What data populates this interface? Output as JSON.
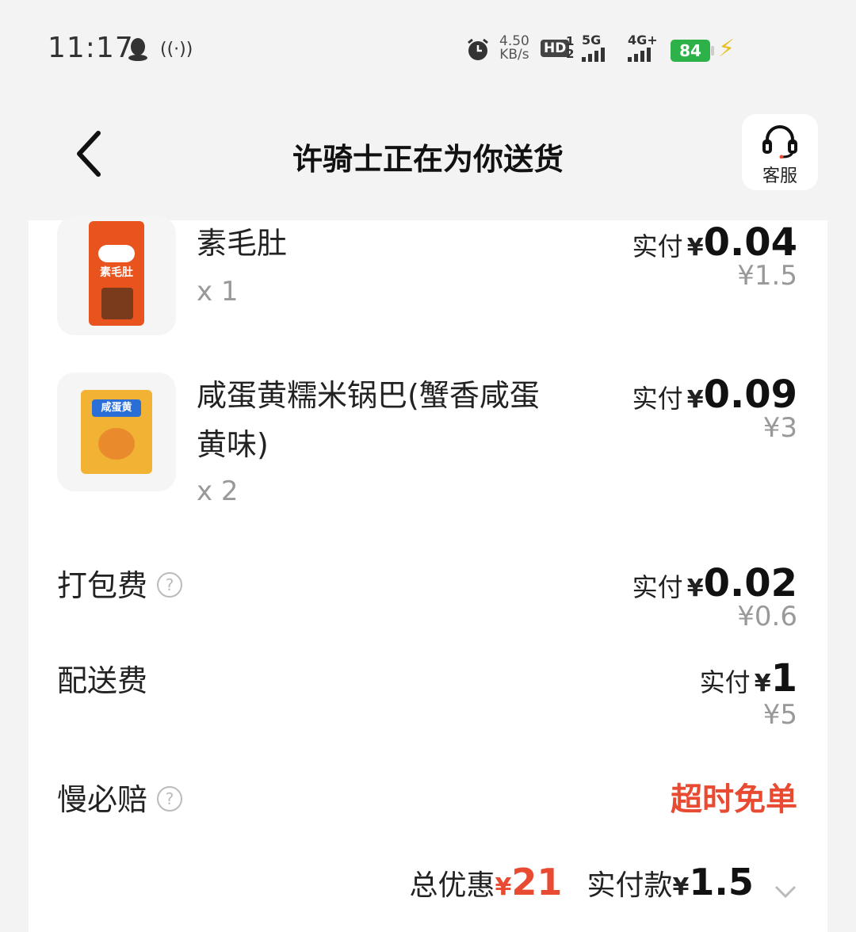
{
  "status_bar": {
    "time": "11:17",
    "speed_value": "4.50",
    "speed_unit": "KB/s",
    "hd": "HD",
    "hd_sub": "1\n2",
    "net1": "5G",
    "net2": "4G+",
    "battery": "84"
  },
  "header": {
    "title": "许骑士正在为你送货",
    "cs_label": "客服"
  },
  "items": [
    {
      "name": "素毛肚",
      "qty": "x 1",
      "paid_label": "实付",
      "currency": "¥",
      "paid": "0.04",
      "original": "¥1.5",
      "thumb_text": "素毛肚"
    },
    {
      "name": "咸蛋黄糯米锅巴(蟹香咸蛋黄味)",
      "qty": "x 2",
      "paid_label": "实付",
      "currency": "¥",
      "paid": "0.09",
      "original": "¥3",
      "thumb_text": "咸蛋黄"
    }
  ],
  "fees": {
    "packing": {
      "label": "打包费",
      "paid_label": "实付",
      "currency": "¥",
      "paid": "0.02",
      "original": "¥0.6"
    },
    "delivery": {
      "label": "配送费",
      "paid_label": "实付",
      "currency": "¥",
      "paid": "1",
      "original": "¥5"
    },
    "slow": {
      "label": "慢必赔",
      "value": "超时免单"
    }
  },
  "summary": {
    "discount_label": "总优惠",
    "currency": "¥",
    "discount": "21",
    "paid_label": "实付款",
    "paid": "1.5"
  },
  "colors": {
    "accent": "#e84a32",
    "battery": "#2db24a"
  }
}
